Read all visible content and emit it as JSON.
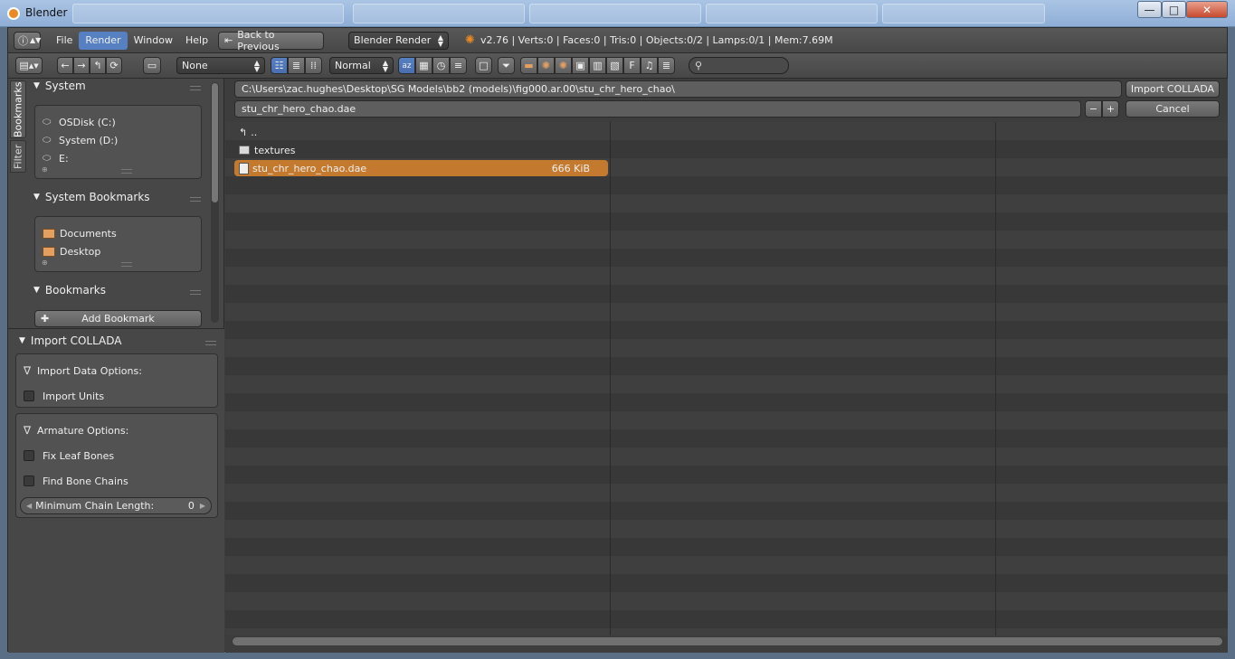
{
  "window": {
    "title": "Blender",
    "minimize": "—",
    "maximize": "□",
    "close": "✕"
  },
  "infobar": {
    "menus": [
      "File",
      "Render",
      "Window",
      "Help"
    ],
    "back_button": "Back to Previous",
    "engine": "Blender Render",
    "stats": "v2.76 | Verts:0 | Faces:0 | Tris:0 | Objects:0/2 | Lamps:0/1 | Mem:7.69M"
  },
  "filebar": {
    "recursion": "None",
    "display_size": "Normal"
  },
  "sidebar": {
    "tabs": [
      "Bookmarks",
      "Filter"
    ],
    "system": {
      "title": "System",
      "items": [
        "OSDisk (C:)",
        "System (D:)",
        "E:"
      ]
    },
    "system_bookmarks": {
      "title": "System Bookmarks",
      "items": [
        "Documents",
        "Desktop"
      ]
    },
    "bookmarks": {
      "title": "Bookmarks",
      "add_label": "Add Bookmark"
    }
  },
  "import_panel": {
    "title": "Import COLLADA",
    "data_options_label": "Import Data Options:",
    "import_units": "Import Units",
    "armature_label": "Armature Options:",
    "fix_leaf_bones": "Fix Leaf Bones",
    "find_bone_chains": "Find Bone Chains",
    "min_chain_label": "Minimum Chain Length:",
    "min_chain_value": "0"
  },
  "browser": {
    "directory": "C:\\Users\\zac.hughes\\Desktop\\SG Models\\bb2 (models)\\fig000.ar.00\\stu_chr_hero_chao\\",
    "filename": "stu_chr_hero_chao.dae",
    "import_button": "Import COLLADA",
    "cancel_button": "Cancel",
    "minus": "−",
    "plus": "+",
    "parent": "..",
    "files": [
      {
        "name": "textures",
        "size": "",
        "type": "folder"
      },
      {
        "name": "stu_chr_hero_chao.dae",
        "size": "666 KiB",
        "type": "file"
      }
    ]
  }
}
